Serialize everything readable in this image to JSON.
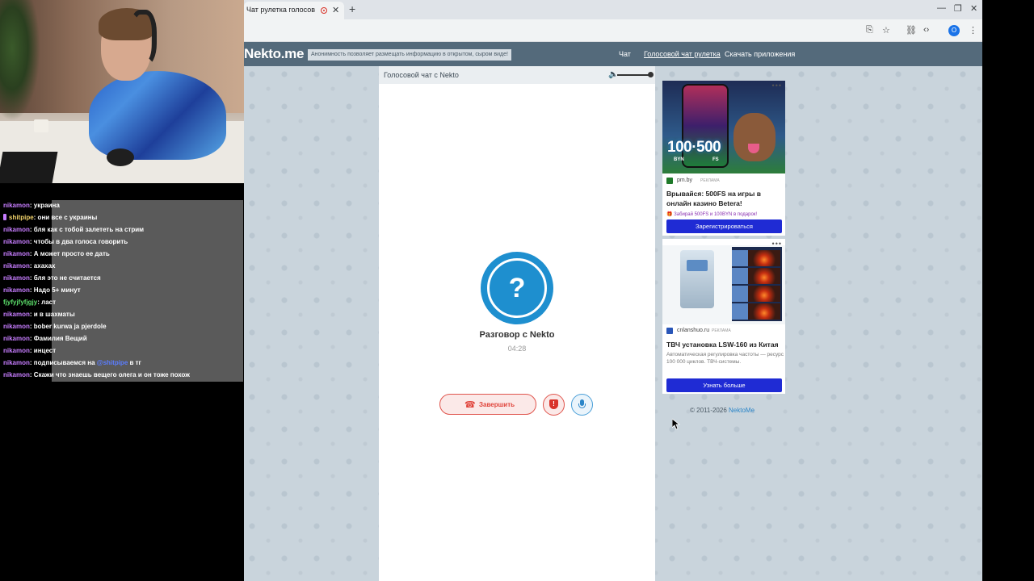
{
  "browser": {
    "tab_title": "Чат рулетка голосов",
    "tab_close": "✕",
    "new_tab": "+",
    "minimize": "—",
    "maximize": "❐",
    "close": "✕",
    "profile_letter": "O"
  },
  "site": {
    "logo": "Nekto.me",
    "notice": "Анонимность позволяет размещать информацию в открытом, сыром виде!",
    "nav": [
      "Чат",
      "Голосовой чат рулетка",
      "Скачать приложения"
    ]
  },
  "panel": {
    "title": "Голосовой чат с Nekto",
    "volume_level": 1.0,
    "avatar_symbol": "?",
    "conversation_title": "Разговор с Nekto",
    "timer": "04:28",
    "end_button": "Завершить",
    "report_symbol": "!"
  },
  "ads": [
    {
      "big_text": "100·500",
      "sub_left": "BYN",
      "sub_right": "FS",
      "source": "pm.by",
      "tag": "РЕКЛАМА",
      "title": "Врывайся: 500FS на игры в онлайн казино Betera!",
      "promo": "Забирай 500FS и 100BYN в подарок!",
      "cta": "Зарегистрироваться"
    },
    {
      "source": "cnlanshuo.ru",
      "tag": "РЕКЛАМА",
      "title": "ТВЧ установка LSW-160 из Китая",
      "description": "Автоматическая регулировка частоты — ресурс 100 000 циклов. ТВЧ-системы.",
      "cta": "Узнать больше"
    }
  ],
  "footer": {
    "copyright": "© 2011-2026",
    "link": "NektoMe"
  },
  "chat": [
    {
      "user": "nikamon",
      "color": "purple",
      "text": ": украина"
    },
    {
      "user": "shitpipe",
      "color": "yellow",
      "badge": true,
      "text": ": они все с украины"
    },
    {
      "user": "nikamon",
      "color": "purple",
      "text": ": бля как с тобой залететь на стрим"
    },
    {
      "user": "nikamon",
      "color": "purple",
      "text": ": чтобы в два голоса говорить"
    },
    {
      "user": "nikamon",
      "color": "purple",
      "text": ": А может просто ее дать"
    },
    {
      "user": "nikamon",
      "color": "purple",
      "text": ": ахахах"
    },
    {
      "user": "nikamon",
      "color": "purple",
      "text": ": бля это не считается"
    },
    {
      "user": "nikamon",
      "color": "purple",
      "text": ": Надо 5+ минут"
    },
    {
      "user": "fjyfyjfyfjgjy",
      "color": "green",
      "text": ": ласт"
    },
    {
      "user": "nikamon",
      "color": "purple",
      "text": ": и в шахматы"
    },
    {
      "user": "nikamon",
      "color": "purple",
      "text": ": bober kurwa ja pjerdole"
    },
    {
      "user": "nikamon",
      "color": "purple",
      "text": ": Фамилия Вещий"
    },
    {
      "user": "nikamon",
      "color": "purple",
      "text": ": инцест"
    },
    {
      "user": "nikamon",
      "color": "purple",
      "text": ": подписываемся на",
      "mention": "@shitpipe",
      "after": " в тг"
    },
    {
      "user": "nikamon",
      "color": "purple",
      "text": ": Скажи что знаешь вещего олега и он тоже похож"
    }
  ]
}
